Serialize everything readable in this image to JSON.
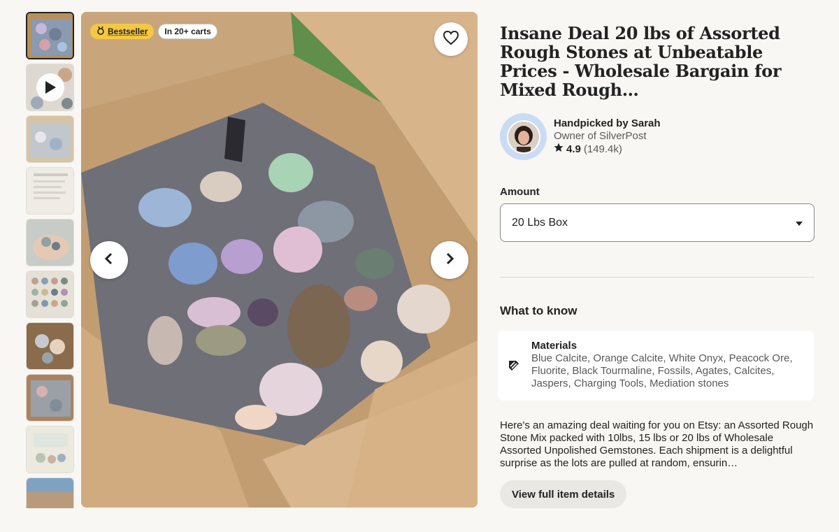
{
  "badges": {
    "bestseller": "Bestseller",
    "carts": "In 20+ carts"
  },
  "listing": {
    "title": "Insane Deal 20 lbs of Assorted Rough Stones at Unbeatable Prices - Wholesale Bargain for Mixed Rough…"
  },
  "seller": {
    "name": "Handpicked by Sarah",
    "owner": "Owner of SilverPost",
    "rating": "4.9",
    "reviews": "(149.4k)"
  },
  "amount": {
    "label": "Amount",
    "selected": "20 Lbs Box"
  },
  "what_to_know": {
    "title": "What to know",
    "materials_title": "Materials",
    "materials_text": "Blue Calcite, Orange Calcite, White Onyx, Peacock Ore, Fluorite, Black Tourmaline, Fossils, Agates, Calcites, Jaspers, Charging Tools, Mediation stones"
  },
  "description": "Here's an amazing deal waiting for you on Etsy: an Assorted Rough Stone Mix packed with 10lbs, 15 lbs or 20 lbs of Wholesale Assorted Unpolished Gemstones. Each shipment is a delightful surprise as the lots are pulled at random, ensurin…",
  "view_details": "View full item details",
  "icons": {
    "favorite": "heart-icon",
    "prev": "chevron-left-icon",
    "next": "chevron-right-icon",
    "play": "play-icon",
    "rating": "star-icon",
    "dropdown": "caret-down-icon",
    "materials": "materials-icon",
    "bestseller": "medal-icon"
  },
  "colors": {
    "bestseller_badge": "#f5c842",
    "avatar_ring": "#c9dcf3",
    "background": "#f8f7f3"
  }
}
